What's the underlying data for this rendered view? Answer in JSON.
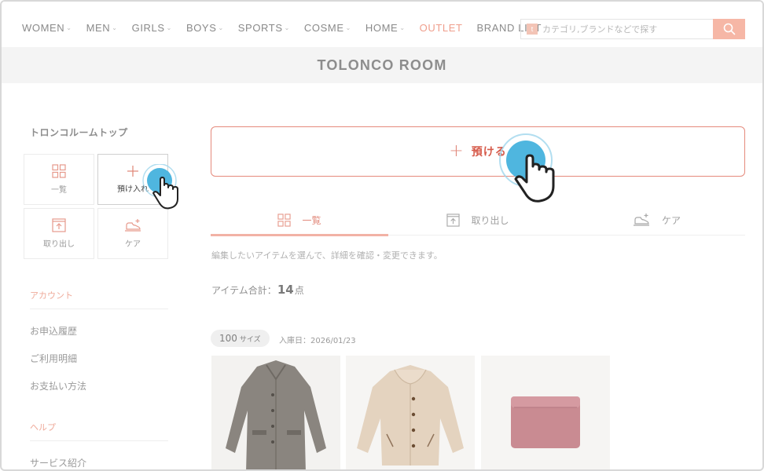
{
  "nav": {
    "items": [
      {
        "label": "WOMEN",
        "caret": true
      },
      {
        "label": "MEN",
        "caret": true
      },
      {
        "label": "GIRLS",
        "caret": true
      },
      {
        "label": "BOYS",
        "caret": true
      },
      {
        "label": "SPORTS",
        "caret": true
      },
      {
        "label": "COSME",
        "caret": true
      },
      {
        "label": "HOME",
        "caret": true
      },
      {
        "label": "OUTLET",
        "caret": false
      },
      {
        "label": "BRAND LIST",
        "caret": false
      }
    ],
    "caret_glyph": "⌄",
    "search": {
      "badge": "t",
      "placeholder": "カテゴリ,ブランドなどで探す"
    }
  },
  "banner": {
    "title": "TOLONCO ROOM"
  },
  "sidebar": {
    "title": "トロンコルームトップ",
    "tiles": [
      {
        "label": "一覧",
        "icon": "grid-icon"
      },
      {
        "label": "預け入れ",
        "icon": "plus-icon"
      },
      {
        "label": "取り出し",
        "icon": "box-out-icon"
      },
      {
        "label": "ケア",
        "icon": "care-icon"
      }
    ],
    "account_heading": "アカウント",
    "account_links": [
      "お申込履歴",
      "ご利用明細",
      "お支払い方法"
    ],
    "help_heading": "ヘルプ",
    "help_links": [
      "サービス紹介"
    ]
  },
  "main": {
    "deposit_label": "預ける",
    "tabs": [
      {
        "label": "一覧",
        "icon": "grid-icon",
        "active": true
      },
      {
        "label": "取り出し",
        "icon": "box-out-icon",
        "active": false
      },
      {
        "label": "ケア",
        "icon": "care-icon",
        "active": false
      }
    ],
    "description": "編集したいアイテムを選んで、詳細を確認・変更できます。",
    "count_prefix": "アイテム合計：",
    "count_value": "14",
    "count_suffix": "点",
    "size_badge_value": "100",
    "size_badge_unit": "サイズ",
    "stock_date": "入庫日：2026/01/23"
  },
  "colors": {
    "accent": "#e58a7c",
    "accent_text": "#d65a4a",
    "search_button": "#f6b7a6",
    "cursor_highlight": "#4fb6df"
  }
}
